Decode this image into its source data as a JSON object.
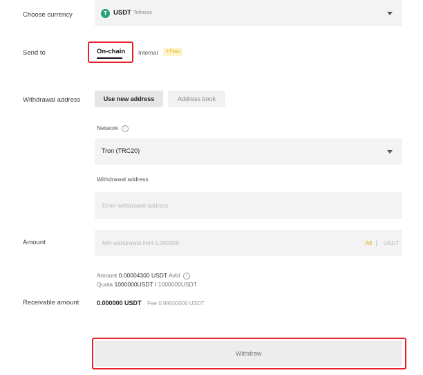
{
  "currency": {
    "label": "Choose currency",
    "code": "USDT",
    "name": "Tetherus",
    "icon": "tether-icon",
    "icon_color": "#26a17b"
  },
  "send_to": {
    "label": "Send to",
    "onchain": "On-chain",
    "internal": "Internal",
    "fee_badge": "0 Fees"
  },
  "withdrawal": {
    "label": "Withdrawal address",
    "use_new": "Use new address",
    "address_book": "Address book",
    "network_label": "Network",
    "network_value": "Tron (TRC20)",
    "address_label": "Withdrawal address",
    "address_placeholder": "Enter withdrawal address"
  },
  "amount": {
    "label": "Amount",
    "placeholder": "Min withdrawal limit 5.000000",
    "all": "All",
    "unit": "USDT",
    "avbl_prefix": "Amount",
    "avbl_value": "0.00004300 USDT",
    "avbl_suffix": "Avbl",
    "quota_prefix": "Quota",
    "quota_used": "1000000USDT",
    "quota_sep": "/",
    "quota_total": "1000000USDT"
  },
  "receivable": {
    "label": "Receivable amount",
    "value": "0.000000 USDT",
    "fee_label": "Fee",
    "fee_value": "0.99000000 USDT"
  },
  "withdraw_button": "Withdraw",
  "colors": {
    "accent_badge_bg": "#fff3cc",
    "accent_badge_text": "#e0a800",
    "highlight": "#e8202a"
  }
}
